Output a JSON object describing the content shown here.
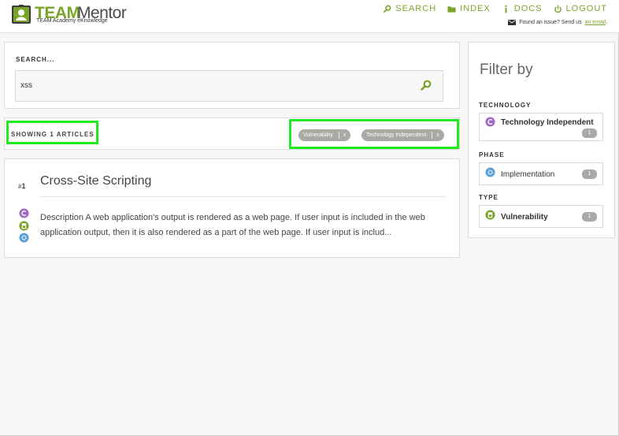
{
  "brand": {
    "name_primary": "TEAM",
    "name_secondary": "Mentor",
    "tagline": "TEAM Academy eKnowledge"
  },
  "nav": {
    "search": "Search",
    "index": "Index",
    "docs": "Docs",
    "logout": "Logout"
  },
  "issue": {
    "text": "Found an issue? Send us",
    "link": "an email",
    "suffix": "."
  },
  "search": {
    "label": "SEARCH...",
    "value": "xss"
  },
  "results": {
    "showing": "SHOWING 1 ARTICLES",
    "active_filters": [
      {
        "label": "Vulnerability",
        "remove": "x"
      },
      {
        "label": "Technology Independent",
        "remove": "x"
      }
    ]
  },
  "article": {
    "number_prefix": "#",
    "number": "1",
    "title": "Cross-Site Scripting",
    "description": "Description A web application's output is rendered as a web page. If user input is included in the web application output, then it is also rendered as a part of the web page. If user input is includ...",
    "icons": [
      "technology-icon",
      "type-icon",
      "phase-icon"
    ]
  },
  "filter": {
    "title": "Filter by",
    "sections": [
      {
        "label": "TECHNOLOGY",
        "item": {
          "label": "Technology Independent",
          "count": "1",
          "icon": "technology-icon"
        }
      },
      {
        "label": "PHASE",
        "item": {
          "label": "Implementation",
          "count": "1",
          "icon": "phase-icon"
        }
      },
      {
        "label": "TYPE",
        "item": {
          "label": "Vulnerability",
          "count": "1",
          "icon": "type-icon"
        }
      }
    ]
  },
  "colors": {
    "accent": "#7aa32a",
    "highlight": "#21ea21",
    "technology": "#a06ac4",
    "phase": "#5aa0d6",
    "type": "#7aa32a"
  }
}
